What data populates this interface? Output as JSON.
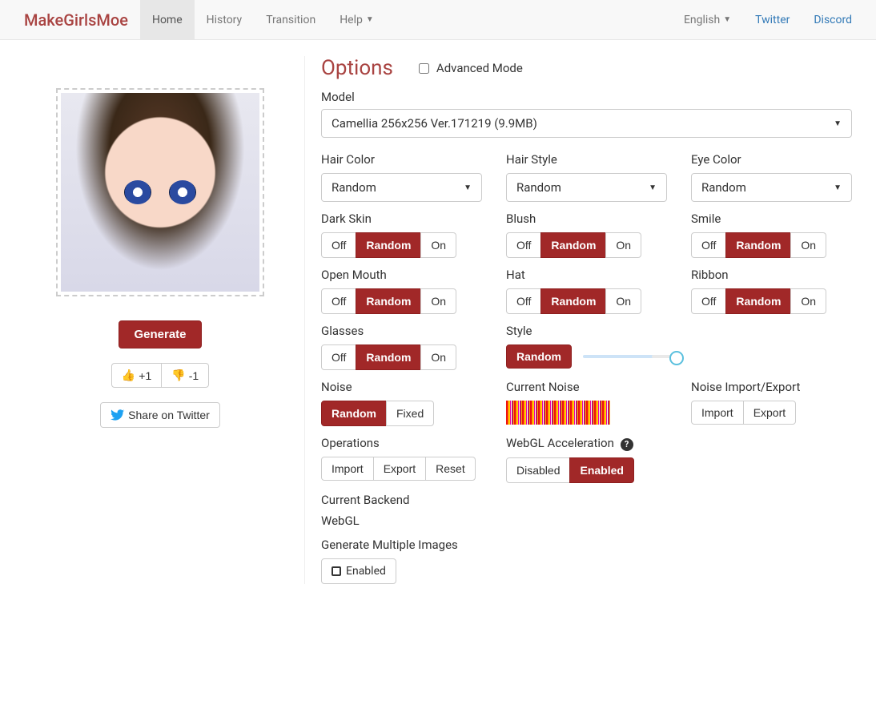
{
  "nav": {
    "brand": "MakeGirlsMoe",
    "items": [
      "Home",
      "History",
      "Transition",
      "Help"
    ],
    "active_index": 0,
    "help_has_caret": true,
    "right": {
      "language": "English",
      "links": [
        "Twitter",
        "Discord"
      ]
    }
  },
  "left": {
    "generate": "Generate",
    "plus_one": "+1",
    "minus_one": "-1",
    "share": "Share on Twitter"
  },
  "options": {
    "title": "Options",
    "advanced_label": "Advanced Mode",
    "advanced_checked": false,
    "model_label": "Model",
    "model_value": "Camellia 256x256 Ver.171219 (9.9MB)",
    "selects": {
      "hair_color": {
        "label": "Hair Color",
        "value": "Random"
      },
      "hair_style": {
        "label": "Hair Style",
        "value": "Random"
      },
      "eye_color": {
        "label": "Eye Color",
        "value": "Random"
      }
    },
    "tri": {
      "labels": {
        "off": "Off",
        "random": "Random",
        "on": "On"
      },
      "items": {
        "dark_skin": {
          "label": "Dark Skin",
          "value": "Random"
        },
        "blush": {
          "label": "Blush",
          "value": "Random"
        },
        "smile": {
          "label": "Smile",
          "value": "Random"
        },
        "open_mouth": {
          "label": "Open Mouth",
          "value": "Random"
        },
        "hat": {
          "label": "Hat",
          "value": "Random"
        },
        "ribbon": {
          "label": "Ribbon",
          "value": "Random"
        },
        "glasses": {
          "label": "Glasses",
          "value": "Random"
        }
      }
    },
    "style": {
      "label": "Style",
      "button": "Random"
    },
    "noise": {
      "label": "Noise",
      "options": [
        "Random",
        "Fixed"
      ],
      "value": "Random"
    },
    "current_noise_label": "Current Noise",
    "io": {
      "label": "Noise Import/Export",
      "import": "Import",
      "export": "Export"
    },
    "ops": {
      "label": "Operations",
      "import": "Import",
      "export": "Export",
      "reset": "Reset"
    },
    "webgl": {
      "label": "WebGL Acceleration",
      "options": [
        "Disabled",
        "Enabled"
      ],
      "value": "Enabled"
    },
    "backend": {
      "label": "Current Backend",
      "value": "WebGL"
    },
    "multi": {
      "label": "Generate Multiple Images",
      "button": "Enabled"
    }
  }
}
